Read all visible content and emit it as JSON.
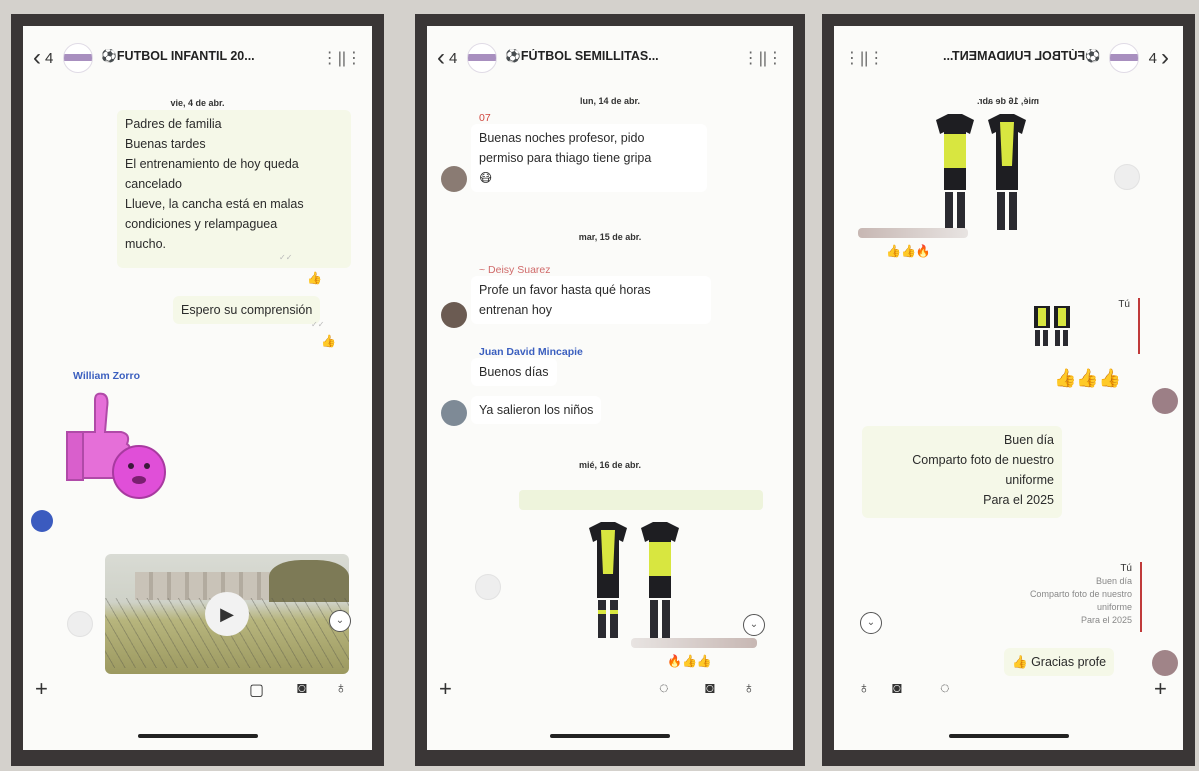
{
  "phones": [
    {
      "header": {
        "back_count": "4",
        "title": "⚽FUTBOL INFANTIL 20...",
        "subtitle": ""
      },
      "messages": {
        "date_1": "vie, 4 de abr.",
        "msg_1_lines": [
          "Padres de familia",
          "Buenas tardes",
          "El entrenamiento de hoy queda",
          "cancelado",
          "Llueve, la cancha está en malas",
          "condiciones y relampaguea",
          "mucho."
        ],
        "msg_1_reaction": "👍",
        "msg_2": "Espero su comprensión",
        "msg_2_reaction": "👍",
        "sender_1": "William Zorro"
      }
    },
    {
      "header": {
        "back_count": "4",
        "title": "⚽FÚTBOL SEMILLITAS...",
        "subtitle": ""
      },
      "messages": {
        "date_1": "lun, 14 de abr.",
        "sender_1": "07",
        "msg_1_lines": [
          "Buenas noches profesor, pido",
          "permiso para thiago tiene gripa"
        ],
        "msg_1_emoji": "😷",
        "date_2": "mar, 15 de abr.",
        "sender_2": "~ Deisy Suarez",
        "msg_2_lines": [
          "Profe un favor hasta qué horas",
          "entrenan hoy"
        ],
        "sender_3": "Juan David Mincapie",
        "msg_3": "Buenos días",
        "msg_4": "Ya salieron los niños",
        "date_3": "mié, 16 de abr.",
        "media_reactions": "🔥👍👍"
      }
    },
    {
      "header": {
        "back_count": "4",
        "title": "⚽FÚTBOL FUNDAMENT...",
        "subtitle": ""
      },
      "messages": {
        "date_1": "mié, 16 de abr.",
        "media_reactions": "👍👍🔥",
        "reply_label": "Tú",
        "big_reactions": "👍👍👍",
        "msg_1_lines": [
          "Buen día",
          "Comparto foto de nuestro",
          "uniforme",
          "Para el 2025"
        ],
        "reply_2_label": "Tú",
        "reply_2_lines": [
          "Buen día",
          "Comparto foto de nuestro uniforme",
          "Para el 2025"
        ],
        "msg_2": "Gracias profe",
        "msg_2_emoji": "👍"
      }
    }
  ],
  "colors": {
    "outgoing_bubble": "#f5f8e8",
    "sender_blue": "#3b5fbf",
    "sender_red": "#d0463e",
    "sender_pink": "#d06a6a"
  }
}
